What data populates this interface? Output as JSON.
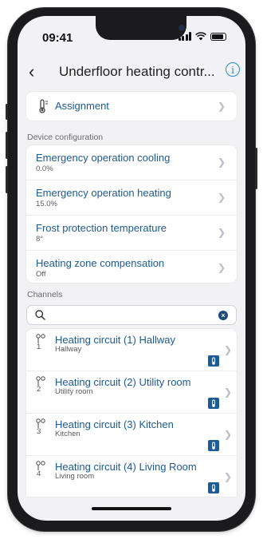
{
  "status_bar": {
    "time": "09:41"
  },
  "nav": {
    "title": "Underfloor heating contr..."
  },
  "assignment": {
    "label": "Assignment"
  },
  "device_configuration": {
    "section_label": "Device configuration",
    "items": [
      {
        "title": "Emergency operation cooling",
        "value": "0.0%"
      },
      {
        "title": "Emergency operation heating",
        "value": "15.0%"
      },
      {
        "title": "Frost protection temperature",
        "value": "8°"
      },
      {
        "title": "Heating zone compensation",
        "value": "Off"
      }
    ]
  },
  "channels": {
    "section_label": "Channels",
    "items": [
      {
        "number": "1",
        "title": "Heating circuit (1) Hallway",
        "subtitle": "Hallway"
      },
      {
        "number": "2",
        "title": "Heating circuit (2) Utility room",
        "subtitle": "Utility room"
      },
      {
        "number": "3",
        "title": "Heating circuit (3) Kitchen",
        "subtitle": "Kitchen"
      },
      {
        "number": "4",
        "title": "Heating circuit (4) Living Room",
        "subtitle": "Living room"
      }
    ]
  },
  "colors": {
    "accent": "#2b8ad8",
    "title_text": "#1d5a92",
    "badge": "#1d5c95"
  }
}
